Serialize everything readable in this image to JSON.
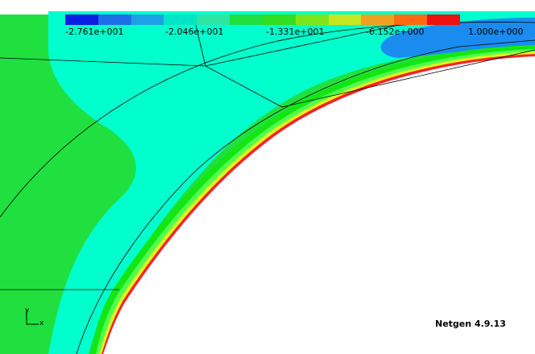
{
  "colorbar": {
    "segments": [
      "#0a1ee6",
      "#1e6ee8",
      "#1fa0e6",
      "#00e5c8",
      "#2ee6a4",
      "#20e040",
      "#33dd22",
      "#7de61a",
      "#c8e620",
      "#f0a020",
      "#ff6a10",
      "#f01010"
    ],
    "labels": [
      "-2.761e+001",
      "-2.046e+001",
      "-1.331e+001",
      "-6.152e+000",
      "1.000e+000"
    ]
  },
  "field_colors": {
    "outer": "#20e040",
    "cyan": "#00ffcc",
    "blue": "#1a8cf0",
    "ring_outer": "#14e614",
    "ring_mid": "#50ff50",
    "ring_yellow": "#d9ff20",
    "ring_red": "#ff2020",
    "hole": "#ffffff"
  },
  "axes": {
    "y": "y",
    "x": "x"
  },
  "brand": "Netgen 4.9.13"
}
